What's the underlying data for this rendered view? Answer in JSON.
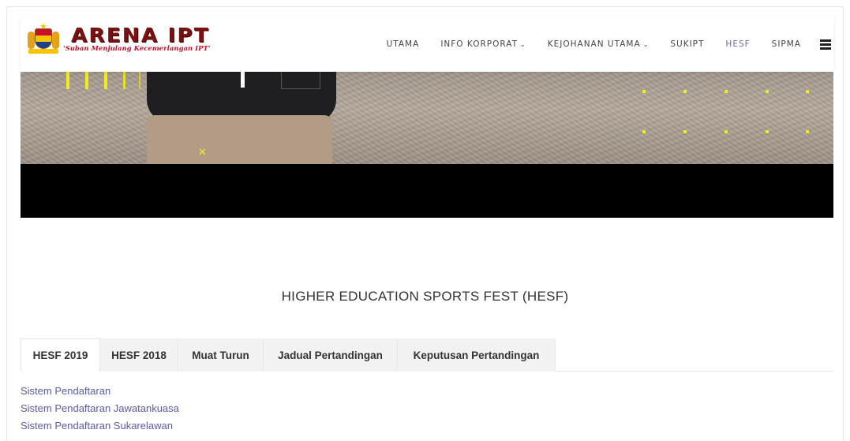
{
  "header": {
    "brand_name": "ARENA IPT",
    "brand_tagline": "'Suban Menjulang Kecemerlangan IPT'",
    "nav": [
      {
        "label": "UTAMA",
        "dropdown": false,
        "active": false
      },
      {
        "label": "INFO KORPORAT",
        "dropdown": true,
        "active": false
      },
      {
        "label": "KEJOHANAN UTAMA",
        "dropdown": true,
        "active": false
      },
      {
        "label": "SUKIPT",
        "dropdown": false,
        "active": false
      },
      {
        "label": "HESF",
        "dropdown": false,
        "active": true
      },
      {
        "label": "SIPMA",
        "dropdown": false,
        "active": false
      }
    ],
    "menu_icon": "hamburger-icon",
    "dropdown_icon": "chevron-down-icon"
  },
  "main": {
    "title": "HIGHER EDUCATION SPORTS FEST (HESF)",
    "tabs": [
      {
        "label": "HESF 2019",
        "active": true
      },
      {
        "label": "HESF 2018",
        "active": false
      },
      {
        "label": "Muat Turun",
        "active": false
      },
      {
        "label": "Jadual Pertandingan",
        "active": false
      },
      {
        "label": "Keputusan Pertandingan",
        "active": false
      }
    ],
    "links": [
      "Sistem Pendaftaran",
      "Sistem Pendaftaran Jawatankuasa",
      "Sistem Pendaftaran Sukarelawan"
    ]
  },
  "colors": {
    "accent": "#6a67b5",
    "link": "#5d5aa8",
    "brand": "#7a1010",
    "hero_highlight": "#f2ec1d"
  }
}
